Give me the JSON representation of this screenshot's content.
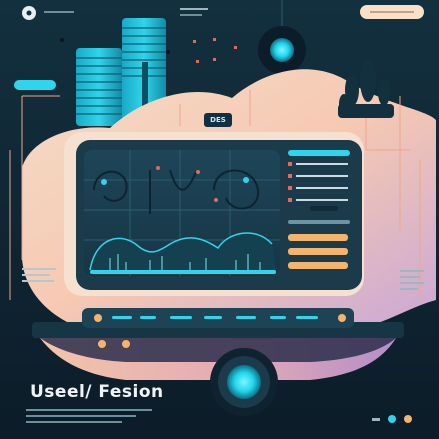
{
  "hero": {
    "title": "Useel/ Fesion",
    "badge": "DES"
  },
  "colors": {
    "background": "#0f2230",
    "panel": "#1d3d4e",
    "accent_cyan": "#28d9ee",
    "accent_orange": "#f5b46c",
    "peach": "#f8d9c0",
    "lavender": "#c8a9d4"
  },
  "icons": {
    "top_left": "circle-dot-icon",
    "bottom_right": [
      "small-text-icon",
      "cyan-dot-icon",
      "orange-dot-icon"
    ]
  }
}
